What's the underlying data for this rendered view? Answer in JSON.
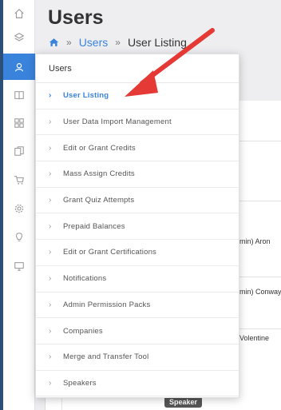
{
  "page": {
    "title": "Users"
  },
  "breadcrumb": {
    "link": "Users",
    "separator": "»",
    "current": "User Listing"
  },
  "rail": {
    "icons": [
      "home-icon",
      "layers-icon",
      "users-icon",
      "book-icon",
      "apps-icon",
      "copy-icon",
      "cart-icon",
      "settings-icon",
      "bulb-icon",
      "monitor-icon"
    ],
    "active_index": 2,
    "accent": "#3a83dc"
  },
  "menu": {
    "heading": "Users",
    "items": [
      {
        "label": "User Listing",
        "active": true
      },
      {
        "label": "User Data Import Management",
        "active": false
      },
      {
        "label": "Edit or Grant Credits",
        "active": false
      },
      {
        "label": "Mass Assign Credits",
        "active": false
      },
      {
        "label": "Grant Quiz Attempts",
        "active": false
      },
      {
        "label": "Prepaid Balances",
        "active": false
      },
      {
        "label": "Edit or Grant Certifications",
        "active": false
      },
      {
        "label": "Notifications",
        "active": false
      },
      {
        "label": "Admin Permission Packs",
        "active": false
      },
      {
        "label": "Companies",
        "active": false
      },
      {
        "label": "Merge and Transfer Tool",
        "active": false
      },
      {
        "label": "Speakers",
        "active": false
      }
    ]
  },
  "background_rows": {
    "cells": [
      "min) Aron",
      "min) Conway",
      "Volentine"
    ],
    "badge": "Speaker"
  },
  "colors": {
    "accent": "#3a83dc",
    "arrow": "#e53935",
    "rail_edge": "#2b4f77"
  }
}
